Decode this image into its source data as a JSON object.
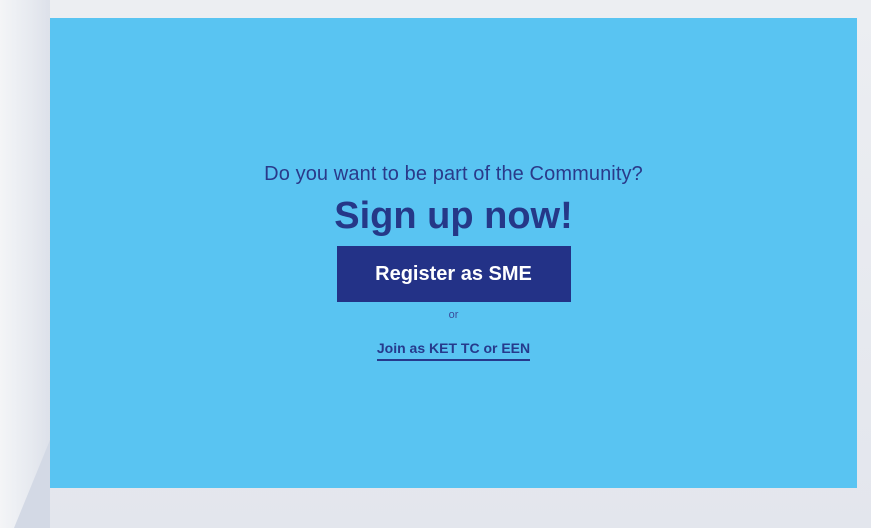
{
  "signup": {
    "question": "Do you want to be part of the Community?",
    "headline": "Sign up now!",
    "register_button": "Register as SME",
    "or_text": "or",
    "join_link": "Join as KET TC or EEN"
  },
  "colors": {
    "panel_background": "#59c4f2",
    "button_background": "#233287",
    "text_dark_blue": "#253888",
    "page_background": "#e6e9ef"
  }
}
